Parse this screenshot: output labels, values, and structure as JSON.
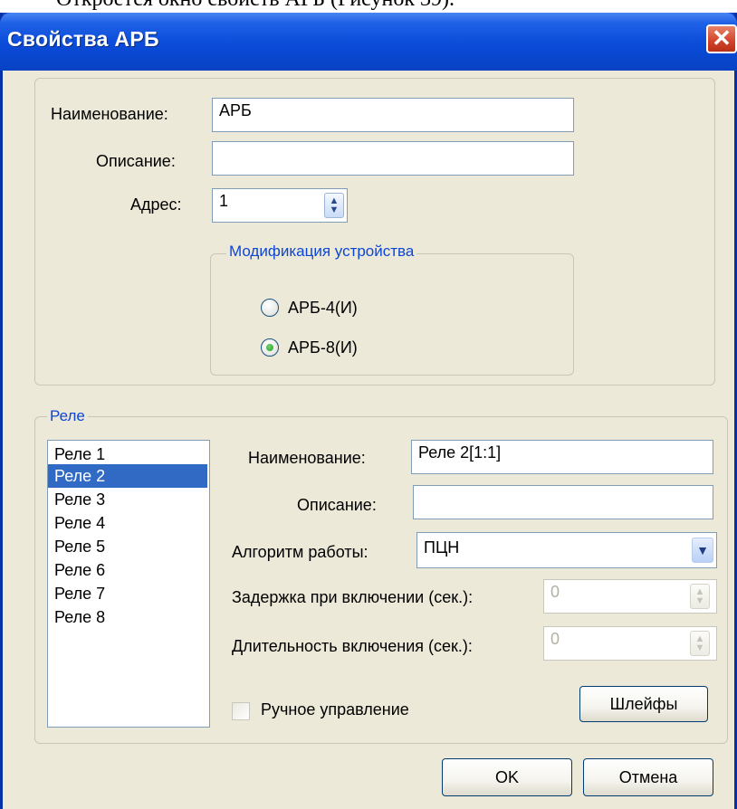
{
  "caption": "Откроется окно свойств АРБ (Рисунок 39).",
  "window": {
    "title": "Свойства АРБ",
    "close_glyph": "✕"
  },
  "device": {
    "name_label": "Наименование:",
    "name_value": "АРБ",
    "desc_label": "Описание:",
    "desc_value": "",
    "addr_label": "Адрес:",
    "addr_value": "1",
    "modification": {
      "legend": "Модификация устройства",
      "options": [
        {
          "label": "АРБ-4(И)",
          "checked": false
        },
        {
          "label": "АРБ-8(И)",
          "checked": true
        }
      ]
    }
  },
  "relay": {
    "legend": "Реле",
    "items": [
      "Реле 1",
      "Реле 2",
      "Реле 3",
      "Реле 4",
      "Реле 5",
      "Реле 6",
      "Реле 7",
      "Реле 8"
    ],
    "selected_index": 1,
    "name_label": "Наименование:",
    "name_value": "Реле 2[1:1]",
    "desc_label": "Описание:",
    "desc_value": "",
    "algo_label": "Алгоритм работы:",
    "algo_value": "ПЦН",
    "delay_label": "Задержка при включении (сек.):",
    "delay_value": "0",
    "duration_label": "Длительность включения (сек.):",
    "duration_value": "0",
    "manual_label": "Ручное управление",
    "manual_checked": false,
    "loops_button": "Шлейфы"
  },
  "buttons": {
    "ok": "OK",
    "cancel": "Отмена"
  },
  "icons": {
    "close": "close-icon",
    "spin": "spin-up-down-icon",
    "combo": "chevron-down-icon"
  }
}
